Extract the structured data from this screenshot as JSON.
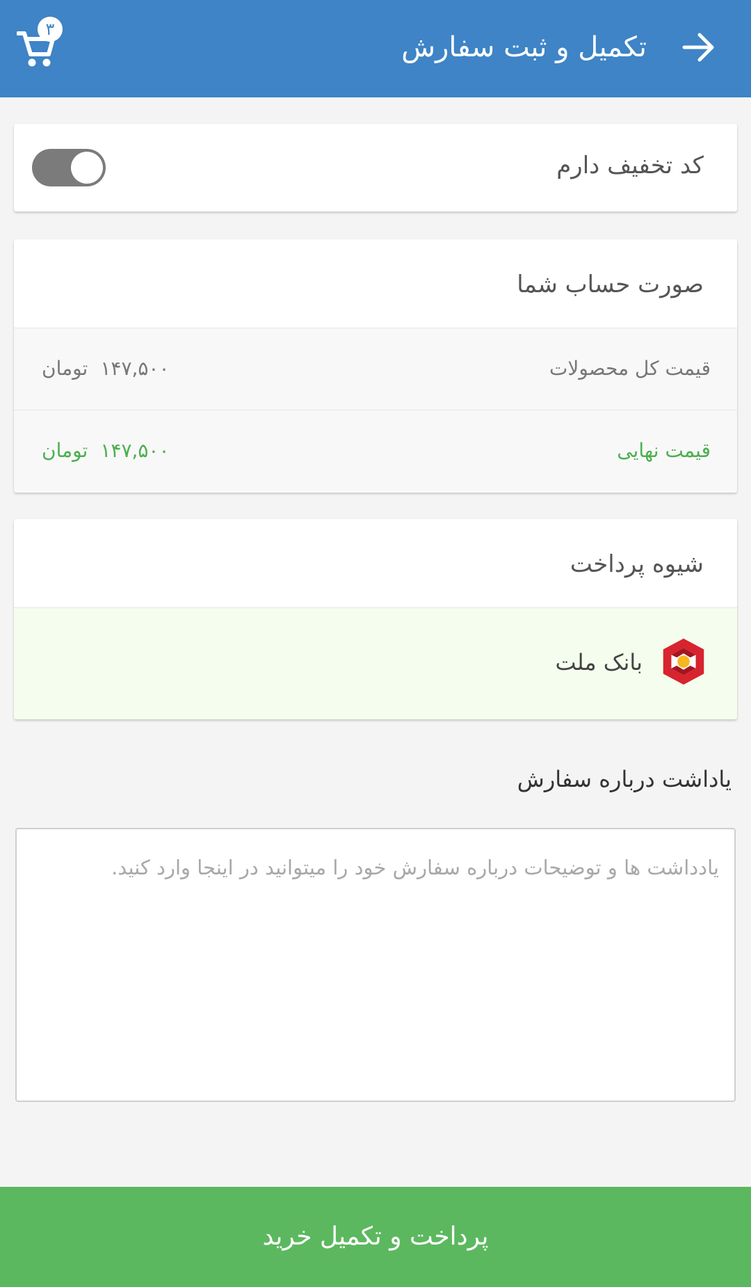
{
  "app_bar": {
    "title": "تکمیل و ثبت سفارش",
    "back_icon": "arrow-right-icon",
    "cart_icon": "cart-icon",
    "cart_count": "۳",
    "background": "#3e84c6"
  },
  "discount": {
    "label": "کد تخفیف دارم",
    "toggle_on": false
  },
  "invoice": {
    "title": "صورت حساب شما",
    "rows": [
      {
        "label": "قیمت کل محصولات",
        "amount": "۱۴۷,۵۰۰",
        "currency": "تومان"
      },
      {
        "label": "قیمت نهایی",
        "amount": "۱۴۷,۵۰۰",
        "currency": "تومان",
        "color": "#4caf50"
      }
    ]
  },
  "payment": {
    "title": "شیوه پرداخت",
    "options": [
      {
        "name": "بانک ملت",
        "icon": "bank-mellat-logo",
        "selected": true
      }
    ]
  },
  "note": {
    "heading": "یاداشت درباره سفارش",
    "placeholder": "یادداشت ها و توضیحات درباره سفارش خود را میتوانید در اینجا وارد کنید.",
    "value": ""
  },
  "submit": {
    "label": "پرداخت و تکمیل خرید",
    "color": "#5cb85f"
  }
}
